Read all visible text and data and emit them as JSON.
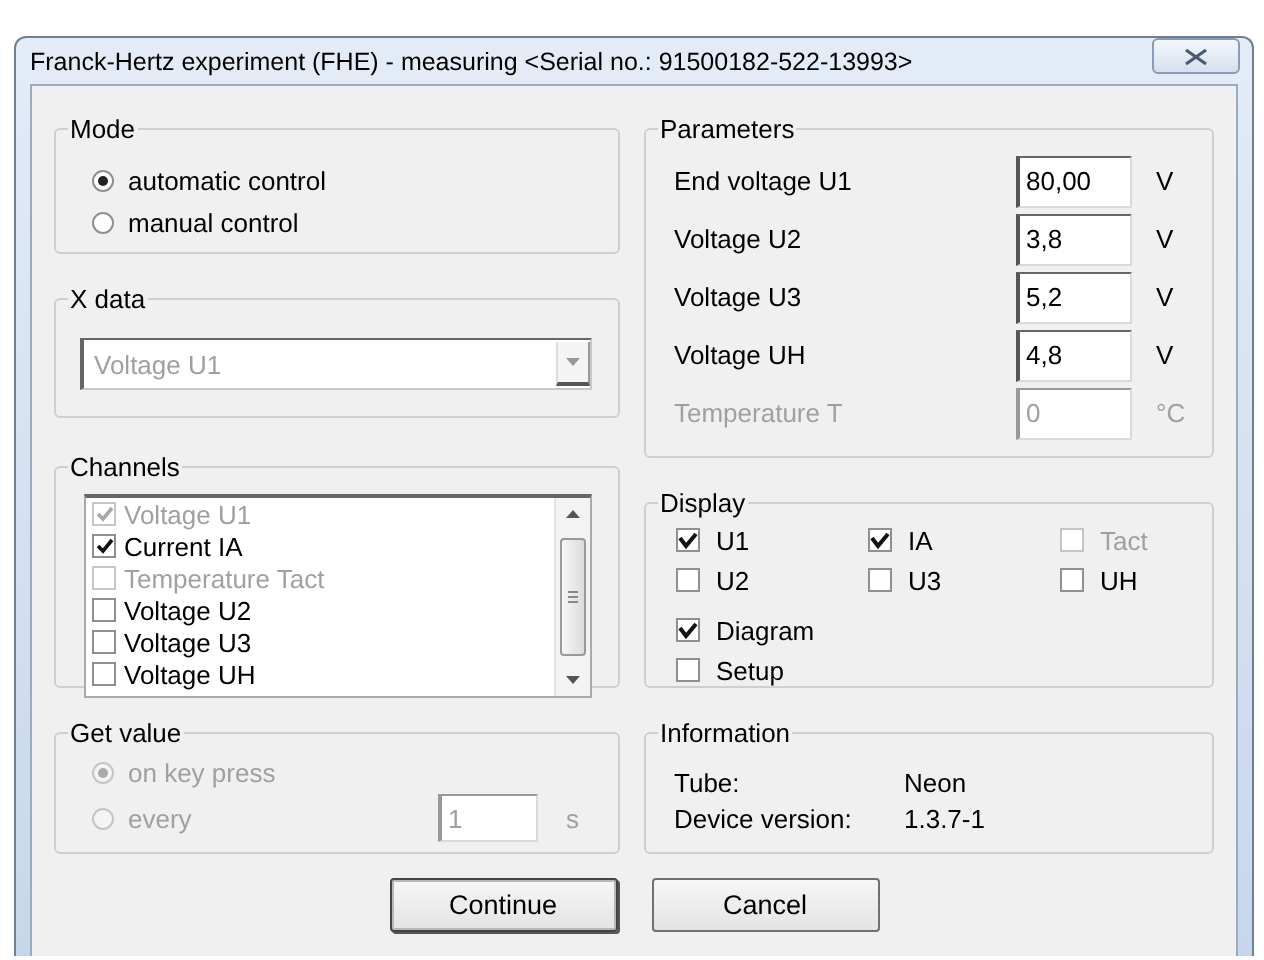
{
  "window": {
    "title": "Franck-Hertz experiment (FHE) - measuring  <Serial no.: 91500182-522-13993>"
  },
  "mode": {
    "label": "Mode",
    "options": [
      {
        "label": "automatic control",
        "selected": true
      },
      {
        "label": "manual control",
        "selected": false
      }
    ]
  },
  "x_data": {
    "label": "X data",
    "value": "Voltage U1",
    "disabled": true
  },
  "channels": {
    "label": "Channels",
    "items": [
      {
        "label": "Voltage U1",
        "checked": true,
        "disabled": true
      },
      {
        "label": "Current IA",
        "checked": true,
        "disabled": false
      },
      {
        "label": "Temperature Tact",
        "checked": false,
        "disabled": true
      },
      {
        "label": "Voltage U2",
        "checked": false,
        "disabled": false
      },
      {
        "label": "Voltage U3",
        "checked": false,
        "disabled": false
      },
      {
        "label": "Voltage UH",
        "checked": false,
        "disabled": false
      }
    ]
  },
  "get_value": {
    "label": "Get value",
    "disabled": true,
    "options": [
      {
        "label": "on key press",
        "selected": true
      },
      {
        "label": "every",
        "selected": false
      }
    ],
    "interval": "1",
    "unit": "s"
  },
  "parameters": {
    "label": "Parameters",
    "rows": [
      {
        "label": "End voltage U1",
        "value": "80,00",
        "unit": "V",
        "disabled": false
      },
      {
        "label": "Voltage U2",
        "value": "3,8",
        "unit": "V",
        "disabled": false
      },
      {
        "label": "Voltage U3",
        "value": "5,2",
        "unit": "V",
        "disabled": false
      },
      {
        "label": "Voltage UH",
        "value": "4,8",
        "unit": "V",
        "disabled": false
      },
      {
        "label": "Temperature T",
        "value": "0",
        "unit": "°C",
        "disabled": true
      }
    ]
  },
  "display": {
    "label": "Display",
    "items": [
      {
        "label": "U1",
        "checked": true,
        "disabled": false
      },
      {
        "label": "IA",
        "checked": true,
        "disabled": false
      },
      {
        "label": "Tact",
        "checked": false,
        "disabled": true
      },
      {
        "label": "U2",
        "checked": false,
        "disabled": false
      },
      {
        "label": "U3",
        "checked": false,
        "disabled": false
      },
      {
        "label": "UH",
        "checked": false,
        "disabled": false
      }
    ],
    "options": [
      {
        "label": "Diagram",
        "checked": true,
        "disabled": false
      },
      {
        "label": "Setup",
        "checked": false,
        "disabled": false
      }
    ]
  },
  "information": {
    "label": "Information",
    "rows": [
      {
        "label": "Tube:",
        "value": "Neon"
      },
      {
        "label": "Device version:",
        "value": "1.3.7-1"
      }
    ]
  },
  "buttons": [
    {
      "label": "Continue",
      "default": true
    },
    {
      "label": "Cancel",
      "default": false
    }
  ]
}
